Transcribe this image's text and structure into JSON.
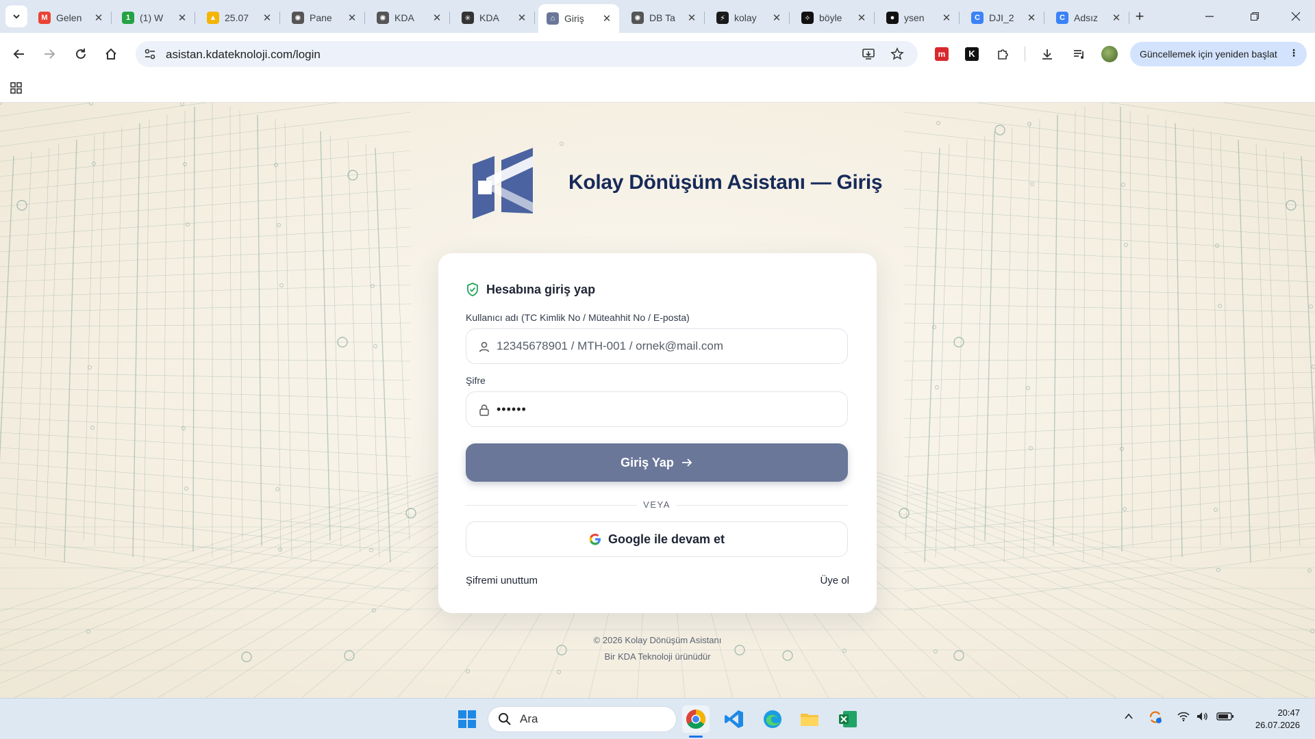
{
  "browser": {
    "tabs": [
      {
        "title": "Gelen",
        "icon": "gmail-icon",
        "color": "#ea4335",
        "glyph": "M"
      },
      {
        "title": "(1) W",
        "icon": "whatsapp-icon",
        "color": "#25a244",
        "glyph": "1"
      },
      {
        "title": "25.07",
        "icon": "drive-icon",
        "color": "#f4b400",
        "glyph": "▲"
      },
      {
        "title": "Pane",
        "icon": "openai-icon",
        "color": "#555555",
        "glyph": "✺"
      },
      {
        "title": "KDA",
        "icon": "openai-icon",
        "color": "#555555",
        "glyph": "✺"
      },
      {
        "title": "KDA",
        "icon": "perplexity-icon",
        "color": "#333333",
        "glyph": "✳"
      },
      {
        "title": "Giriş",
        "icon": "site-icon",
        "color": "#6a7799",
        "glyph": "⌂",
        "active": true
      },
      {
        "title": "DB Ta",
        "icon": "openai-icon",
        "color": "#555555",
        "glyph": "✺"
      },
      {
        "title": "kolay",
        "icon": "bolt-icon",
        "color": "#1a1a1a",
        "glyph": "⚡"
      },
      {
        "title": "böyle",
        "icon": "grok-icon",
        "color": "#111111",
        "glyph": "✧"
      },
      {
        "title": "ysen",
        "icon": "github-icon",
        "color": "#111111",
        "glyph": "●"
      },
      {
        "title": "DJI_2",
        "icon": "canva-icon",
        "color": "#3b82f6",
        "glyph": "C"
      },
      {
        "title": "Adsız",
        "icon": "canva-icon",
        "color": "#3b82f6",
        "glyph": "C"
      }
    ],
    "new_tab": "+",
    "url": "asistan.kdateknoloji.com/login",
    "update_button": "Güncellemek için yeniden başlat",
    "more": "⋮"
  },
  "page": {
    "title": "Kolay Dönüşüm Asistanı — Giriş",
    "card_title": "Hesabına giriş yap",
    "username_label": "Kullanıcı adı (TC Kimlik No / Müteahhit No / E-posta)",
    "username_placeholder": "12345678901 / MTH-001 / ornek@mail.com",
    "password_label": "Şifre",
    "password_value": "••••••",
    "login_button": "Giriş Yap",
    "divider": "VEYA",
    "google_button": "Google ile devam et",
    "forgot_link": "Şifremi unuttum",
    "signup_link": "Üye ol",
    "footer_copyright": "© 2026 Kolay Dönüşüm Asistanı",
    "footer_company": "Bir KDA Teknoloji ürünüdür",
    "colors": {
      "primary": "#6a7799",
      "brand": "#172a5a",
      "logo": "#4b63a0"
    }
  },
  "taskbar": {
    "search_placeholder": "Ara",
    "apps": [
      "windows-start-icon",
      "chrome-icon",
      "vscode-icon",
      "edge-icon",
      "file-explorer-icon",
      "excel-icon"
    ],
    "time": "20:47",
    "date": "26.07.2026"
  }
}
